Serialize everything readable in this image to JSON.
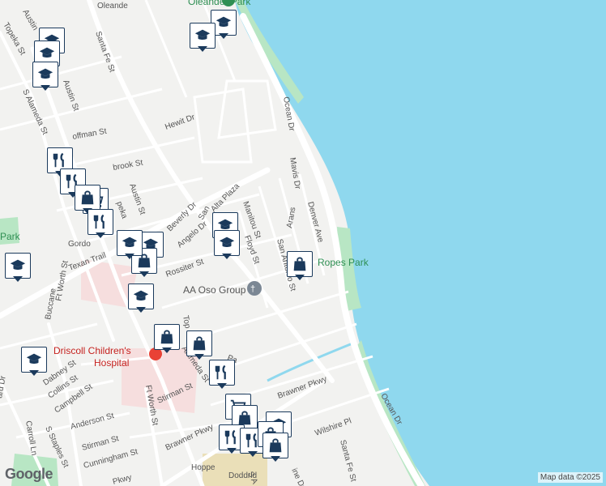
{
  "map": {
    "colors": {
      "water": "#8fd8ee",
      "land": "#f2f2f0",
      "road": "#ffffff",
      "park": "#b8e6c4",
      "hospital": "#f6dede",
      "marker_border": "#1b3a5c"
    },
    "labels": {
      "oleander_park": "Oleander Park",
      "ropes_park": "Ropes Park",
      "left_park": "Park",
      "aa_oso": "AA Oso Group",
      "hospital_line1": "Driscoll Children's",
      "hospital_line2": "Hospital",
      "streets": {
        "topeka_top": "Topeka St",
        "austin_top": "Austin",
        "santa_fe": "Santa Fe St",
        "oleander_top": "Oleande",
        "s_alameda": "S Alameda St",
        "austin_mid": "Austin St",
        "hoffman": "offman St",
        "hewit": "Hewit Dr",
        "ocean_dr_top": "Ocean Dr",
        "mavis": "Mavis Dr",
        "denver": "Denver Ave",
        "brook": "brook St",
        "austin_low": "Austin St",
        "peka": "peka",
        "gordon": "Gordo",
        "texan": "Texan Trail",
        "beverly": "Beverly Dr",
        "san_plaza": "San",
        "alta_plaza": "Alta Plaza",
        "manitou": "Manitou St",
        "angelo": "Angelo Dr",
        "floyd": "Floyd St",
        "aransas": "Arans",
        "san_antonio": "San Antonio St",
        "rossiter": "Rossiter St",
        "ft_worth_top": "Ft Worth St",
        "buccaneer": "Buccane",
        "topeka_low": "Top",
        "alameda_low": "Alameda St",
        "ocean_dr_bottom": "Ocean Dr",
        "brawner_top": "Brawner Pkwy",
        "dabney": "Dabney St",
        "collins": "Collins St",
        "campbell": "Campbell St",
        "anderson": "Anderson St",
        "ft_worth_low": "Ft Worth St",
        "stirman_top": "Stirman St",
        "stirman_low": "Stirman St",
        "brawner_low": "Brawner Pkwy",
        "cunningham": "Cunningham St",
        "carroll": "Carroll Ln",
        "s_staples": "S Staples St",
        "ward": "ard Dr",
        "pkwy": "Pkwy",
        "hopper": "Hoppe",
        "doddridge": "Doddrid",
        "wilshire": "Wilshire Pl",
        "santa_fe_low": "Santa Fe St",
        "s_a": "S A",
        "ine": "ine Dr",
        "pa": "Pa"
      }
    },
    "markers": [
      {
        "icon": "school-icon"
      },
      {
        "icon": "school-icon"
      },
      {
        "icon": "school-icon"
      },
      {
        "icon": "school-icon"
      },
      {
        "icon": "school-icon"
      },
      {
        "icon": "restaurant-icon"
      },
      {
        "icon": "restaurant-icon"
      },
      {
        "icon": "cart-icon"
      },
      {
        "icon": "shopping-bag-icon"
      },
      {
        "icon": "restaurant-icon"
      },
      {
        "icon": "school-icon"
      },
      {
        "icon": "school-icon"
      },
      {
        "icon": "school-icon"
      },
      {
        "icon": "school-icon"
      },
      {
        "icon": "shopping-bag-icon"
      },
      {
        "icon": "school-icon"
      },
      {
        "icon": "shopping-bag-icon"
      },
      {
        "icon": "school-icon"
      },
      {
        "icon": "school-icon"
      },
      {
        "icon": "shopping-bag-icon"
      },
      {
        "icon": "shopping-bag-icon"
      },
      {
        "icon": "restaurant-icon"
      },
      {
        "icon": "cart-icon"
      },
      {
        "icon": "shopping-bag-icon"
      },
      {
        "icon": "school-icon"
      },
      {
        "icon": "restaurant-icon"
      },
      {
        "icon": "restaurant-icon"
      },
      {
        "icon": "shopping-bag-icon"
      },
      {
        "icon": "shopping-bag-icon"
      }
    ],
    "logo": "Google",
    "attribution": "Map data ©2025"
  }
}
